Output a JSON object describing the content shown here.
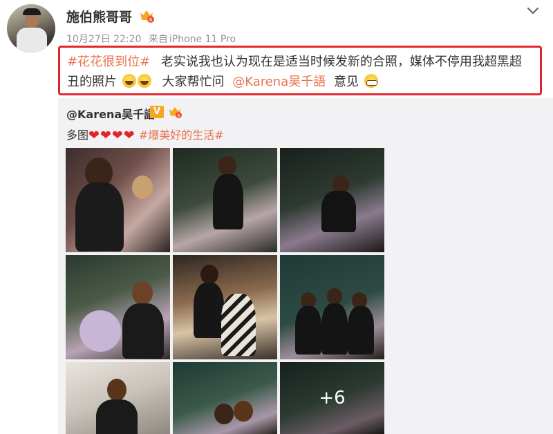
{
  "author": {
    "name": "施伯熊哥哥",
    "timestamp": "10月27日 22:20",
    "source_prefix": "来自",
    "source": "iPhone 11 Pro"
  },
  "post": {
    "hashtag": "#花花很到位#",
    "text1": "老实说我也认为现在是适当时候发新的合照，媒体不停用我超黑超丑的照片",
    "text2": "大家帮忙问",
    "mention": "@Karena吴千語",
    "text3": "意见"
  },
  "repost": {
    "author": "@Karena吴千語",
    "v_label": "V",
    "prefix": "多图",
    "hashtag": "#爆美好的生活#",
    "hearts": [
      "❤",
      "❤",
      "❤",
      "❤"
    ],
    "more_count": "+6"
  },
  "colors": {
    "link": "#eb7350",
    "highlight_border": "#e3252d",
    "repost_bg": "#f2f2f5"
  },
  "icons": {
    "vip": "vip-badge-icon",
    "collapse": "chevron-down-icon",
    "laugh": "laugh-cry-emoji",
    "grin": "grimace-emoji"
  }
}
